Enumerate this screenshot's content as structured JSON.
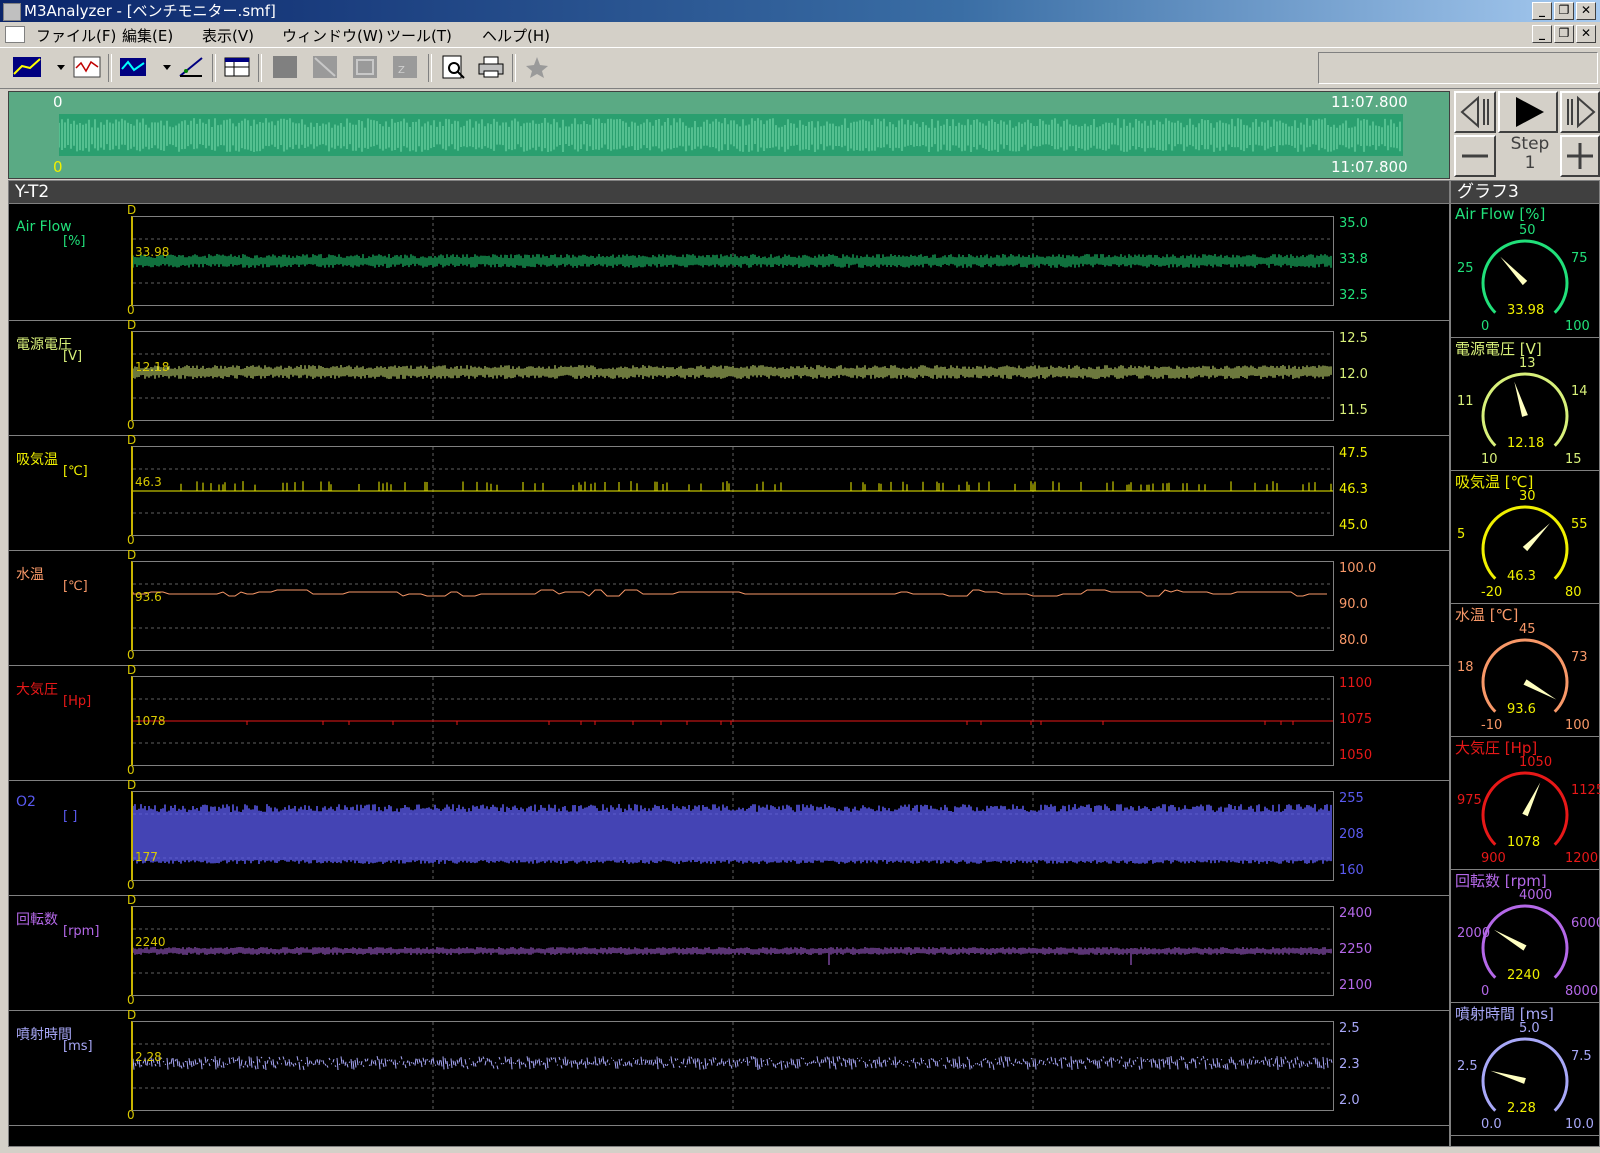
{
  "window": {
    "title": "M3Analyzer - [ベンチモニター.smf]"
  },
  "menu": [
    "ファイル(F)",
    "編集(E)",
    "表示(V)",
    "ウィンドウ(W)",
    "ツール(T)",
    "ヘルプ(H)"
  ],
  "overview": {
    "start_top": "0",
    "end_top": "11:07.800",
    "start_bottom": "0",
    "end_bottom": "11:07.800"
  },
  "nav": {
    "step_label": "Step",
    "step_value": "1"
  },
  "yt": {
    "title": "Y-T2",
    "axis_start_marker": "0",
    "channels": [
      {
        "name": "Air Flow",
        "unit": "[%]",
        "color": "#21e07a",
        "ticks": [
          "35.0",
          "33.8",
          "32.5"
        ],
        "current": "33.98"
      },
      {
        "name": "電源電圧",
        "unit": "[V]",
        "color": "#d8f07a",
        "ticks": [
          "12.5",
          "12.0",
          "11.5"
        ],
        "current": "12.18"
      },
      {
        "name": "吸気温",
        "unit": "[℃]",
        "color": "#f0f000",
        "ticks": [
          "47.5",
          "46.3",
          "45.0"
        ],
        "current": "46.3"
      },
      {
        "name": "水温",
        "unit": "[℃]",
        "color": "#f89868",
        "ticks": [
          "100.0",
          "90.0",
          "80.0"
        ],
        "current": "93.6"
      },
      {
        "name": "大気圧",
        "unit": "[Hp]",
        "color": "#e81818",
        "ticks": [
          "1100",
          "1075",
          "1050"
        ],
        "current": "1078"
      },
      {
        "name": "O2",
        "unit": "[ ]",
        "color": "#5a5af0",
        "ticks": [
          "255",
          "208",
          "160"
        ],
        "current": "177"
      },
      {
        "name": "回転数",
        "unit": "[rpm]",
        "color": "#b468e8",
        "ticks": [
          "2400",
          "2250",
          "2100"
        ],
        "current": "2240"
      },
      {
        "name": "噴射時間",
        "unit": "[ms]",
        "color": "#a8a8f8",
        "ticks": [
          "2.5",
          "2.3",
          "2.0"
        ],
        "current": "2.28"
      }
    ]
  },
  "gauges": {
    "title": "グラフ3",
    "items": [
      {
        "title": "Air Flow [%]",
        "color": "#21e07a",
        "min": "0",
        "max": "100",
        "left": "25",
        "top": "50",
        "right": "75",
        "value_text": "33.98",
        "frac": 0.3398
      },
      {
        "title": "電源電圧 [V]",
        "color": "#d8f07a",
        "min": "10",
        "max": "15",
        "left": "11",
        "top": "13",
        "right": "14",
        "value_text": "12.18",
        "frac": 0.436
      },
      {
        "title": "吸気温 [℃]",
        "color": "#f0f000",
        "min": "-20",
        "max": "80",
        "left": "5",
        "top": "30",
        "right": "55",
        "value_text": "46.3",
        "frac": 0.663
      },
      {
        "title": "水温 [℃]",
        "color": "#f89868",
        "min": "-10",
        "max": "100",
        "left": "18",
        "top": "45",
        "right": "73",
        "value_text": "93.6",
        "frac": 0.9418
      },
      {
        "title": "大気圧 [Hp]",
        "color": "#e81818",
        "min": "900",
        "max": "1200",
        "left": "975",
        "top": "1050",
        "right": "1125",
        "value_text": "1078",
        "frac": 0.5933
      },
      {
        "title": "回転数 [rpm]",
        "color": "#b468e8",
        "min": "0",
        "max": "8000",
        "left": "2000",
        "top": "4000",
        "right": "6000",
        "value_text": "2240",
        "frac": 0.28
      },
      {
        "title": "噴射時間 [ms]",
        "color": "#a8a8f8",
        "min": "0.0",
        "max": "10.0",
        "left": "2.5",
        "top": "5.0",
        "right": "7.5",
        "value_text": "2.28",
        "frac": 0.228
      }
    ]
  }
}
